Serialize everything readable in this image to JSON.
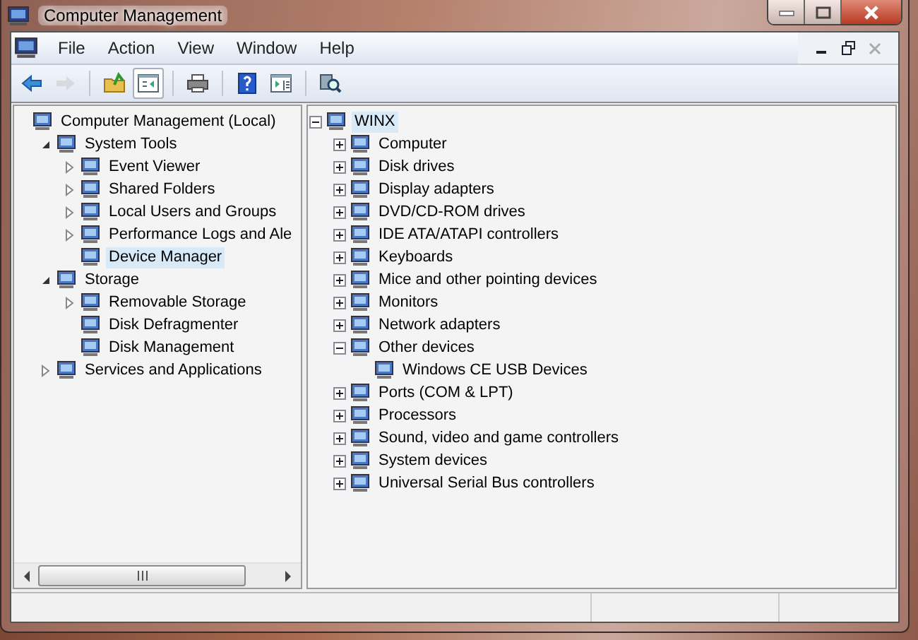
{
  "window": {
    "title": "Computer Management"
  },
  "menu": [
    {
      "label": "File"
    },
    {
      "label": "Action"
    },
    {
      "label": "View"
    },
    {
      "label": "Window"
    },
    {
      "label": "Help"
    }
  ],
  "toolbar": [
    {
      "kind": "back",
      "disabled": false,
      "pressed": false
    },
    {
      "kind": "forward",
      "disabled": true,
      "pressed": false
    },
    {
      "kind": "sep"
    },
    {
      "kind": "up",
      "disabled": false,
      "pressed": false
    },
    {
      "kind": "tree",
      "disabled": false,
      "pressed": true
    },
    {
      "kind": "sep"
    },
    {
      "kind": "print",
      "disabled": false,
      "pressed": false
    },
    {
      "kind": "sep"
    },
    {
      "kind": "help",
      "disabled": false,
      "pressed": false
    },
    {
      "kind": "pane",
      "disabled": false,
      "pressed": false
    },
    {
      "kind": "sep"
    },
    {
      "kind": "scan",
      "disabled": false,
      "pressed": false
    }
  ],
  "console_tree": [
    {
      "label": "Computer Management (Local)",
      "selected": false,
      "children": [
        {
          "label": "System Tools",
          "expanded": true,
          "selected": false,
          "children": [
            {
              "label": "Event Viewer",
              "expanded": false,
              "selected": false
            },
            {
              "label": "Shared Folders",
              "expanded": false,
              "selected": false
            },
            {
              "label": "Local Users and Groups",
              "expanded": false,
              "selected": false
            },
            {
              "label": "Performance Logs and Ale",
              "expanded": false,
              "selected": false
            },
            {
              "label": "Device Manager",
              "selected": true
            }
          ]
        },
        {
          "label": "Storage",
          "expanded": true,
          "selected": false,
          "children": [
            {
              "label": "Removable Storage",
              "expanded": false,
              "selected": false
            },
            {
              "label": "Disk Defragmenter",
              "selected": false
            },
            {
              "label": "Disk Management",
              "selected": false
            }
          ]
        },
        {
          "label": "Services and Applications",
          "expanded": false,
          "selected": false
        }
      ]
    }
  ],
  "device_tree": [
    {
      "label": "WINX",
      "expanded": true,
      "selected": true,
      "children": [
        {
          "label": "Computer",
          "expanded": false,
          "selected": false
        },
        {
          "label": "Disk drives",
          "expanded": false,
          "selected": false
        },
        {
          "label": "Display adapters",
          "expanded": false,
          "selected": false
        },
        {
          "label": "DVD/CD-ROM drives",
          "expanded": false,
          "selected": false
        },
        {
          "label": "IDE ATA/ATAPI controllers",
          "expanded": false,
          "selected": false
        },
        {
          "label": "Keyboards",
          "expanded": false,
          "selected": false
        },
        {
          "label": "Mice and other pointing devices",
          "expanded": false,
          "selected": false
        },
        {
          "label": "Monitors",
          "expanded": false,
          "selected": false
        },
        {
          "label": "Network adapters",
          "expanded": false,
          "selected": false
        },
        {
          "label": "Other devices",
          "expanded": true,
          "selected": false,
          "children": [
            {
              "label": "Windows CE USB Devices",
              "selected": false
            }
          ]
        },
        {
          "label": "Ports (COM & LPT)",
          "expanded": false,
          "selected": false
        },
        {
          "label": "Processors",
          "expanded": false,
          "selected": false
        },
        {
          "label": "Sound, video and game controllers",
          "expanded": false,
          "selected": false
        },
        {
          "label": "System devices",
          "expanded": false,
          "selected": false
        },
        {
          "label": "Universal Serial Bus controllers",
          "expanded": false,
          "selected": false
        }
      ]
    }
  ]
}
